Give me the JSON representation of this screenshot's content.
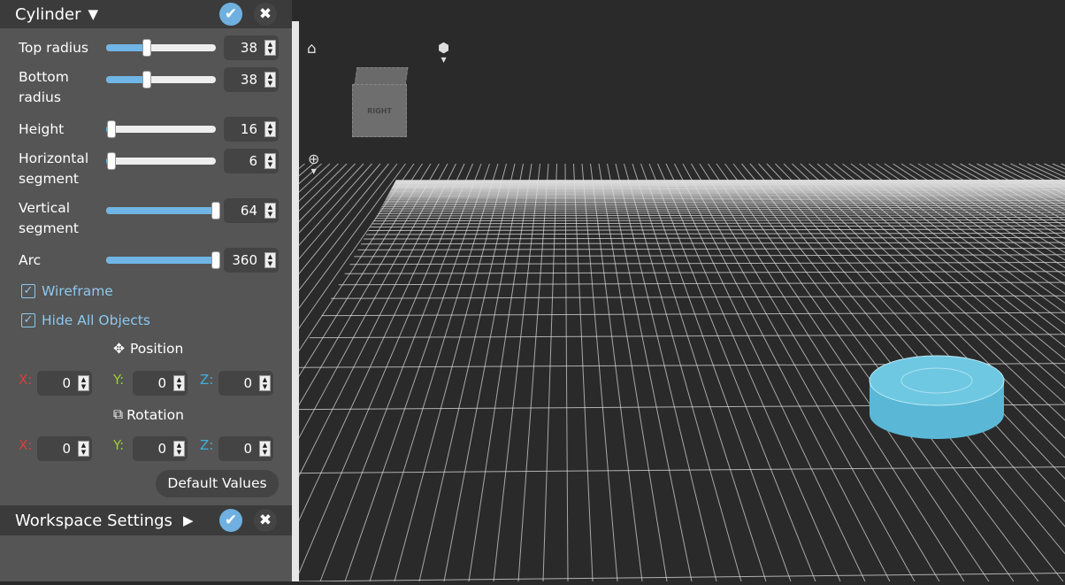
{
  "cylinder_panel": {
    "title": "Cylinder",
    "expand_icon": "triangle-down",
    "params": [
      {
        "label": "Top radius",
        "value": "38",
        "fill": 0.37
      },
      {
        "label": "Bottom radius",
        "value": "38",
        "fill": 0.37
      },
      {
        "label": "Height",
        "value": "16",
        "fill": 0.05
      },
      {
        "label": "Horizontal segment",
        "value": "6",
        "fill": 0.05
      },
      {
        "label": "Vertical segment",
        "value": "64",
        "fill": 1.0
      },
      {
        "label": "Arc",
        "value": "360",
        "fill": 1.0
      }
    ],
    "wireframe": {
      "label": "Wireframe",
      "checked": true
    },
    "hide_all": {
      "label": "Hide All Objects",
      "checked": true
    },
    "position": {
      "label": "Position",
      "x_label": "X:",
      "y_label": "Y:",
      "z_label": "Z:",
      "x": "0",
      "y": "0",
      "z": "0"
    },
    "rotation": {
      "label": "Rotation",
      "x_label": "X:",
      "y_label": "Y:",
      "z_label": "Z:",
      "x": "0",
      "y": "0",
      "z": "0"
    },
    "default_button": "Default Values"
  },
  "workspace_panel": {
    "title": "Workspace Settings",
    "expand_icon": "triangle-right"
  },
  "viewport": {
    "cube_face_label": "RIGHT"
  },
  "colors": {
    "accent": "#6fb6e6",
    "axis_x": "#d94040",
    "axis_y": "#9ad030",
    "axis_z": "#40b0e0",
    "cylinder": "#5ab8d6"
  }
}
